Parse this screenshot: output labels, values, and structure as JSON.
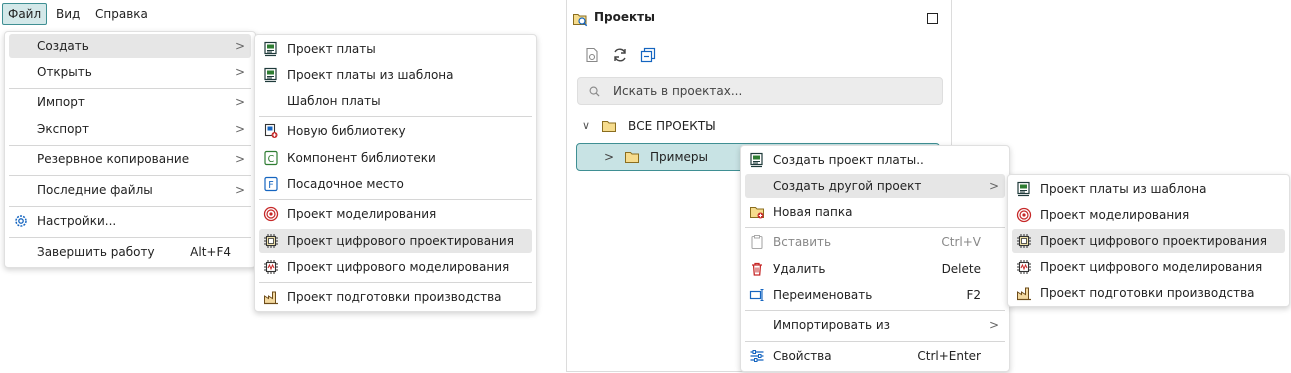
{
  "menubar": {
    "file": "Файл",
    "view": "Вид",
    "help": "Справка"
  },
  "file_menu": {
    "create": "Создать",
    "open": "Открыть",
    "import": "Импорт",
    "export": "Экспорт",
    "backup": "Резервное копирование",
    "recent": "Последние файлы",
    "settings": "Настройки...",
    "exit": "Завершить работу",
    "exit_shortcut": "Alt+F4"
  },
  "create_submenu": {
    "board_project": "Проект платы",
    "board_from_template": "Проект платы из шаблона",
    "board_template": "Шаблон платы",
    "new_library": "Новую библиотеку",
    "library_component": "Компонент библиотеки",
    "footprint": "Посадочное место",
    "simulation_project": "Проект моделирования",
    "digital_design_project": "Проект цифрового проектирования",
    "digital_sim_project": "Проект цифрового моделирования",
    "manufacturing_project": "Проект подготовки производства"
  },
  "projects_panel": {
    "title": "Проекты",
    "search_placeholder": "Искать в проектах...",
    "all_projects": "ВСЕ ПРОЕКТЫ",
    "examples": "Примеры"
  },
  "context_menu": {
    "create_board": "Создать проект платы..",
    "create_other": "Создать другой проект",
    "new_folder": "Новая папка",
    "paste": "Вставить",
    "paste_shortcut": "Ctrl+V",
    "delete": "Удалить",
    "delete_shortcut": "Delete",
    "rename": "Переименовать",
    "rename_shortcut": "F2",
    "import_from": "Импортировать из",
    "properties": "Свойства",
    "properties_shortcut": "Ctrl+Enter"
  },
  "other_submenu": {
    "board_from_template": "Проект платы из шаблона",
    "simulation_project": "Проект моделирования",
    "digital_design_project": "Проект цифрового проектирования",
    "digital_sim_project": "Проект цифрового моделирования",
    "manufacturing_project": "Проект подготовки производства"
  },
  "colors": {
    "accent": "#3f8f93",
    "highlight": "#e6e6e6",
    "selected_row": "#c8e3e4"
  }
}
